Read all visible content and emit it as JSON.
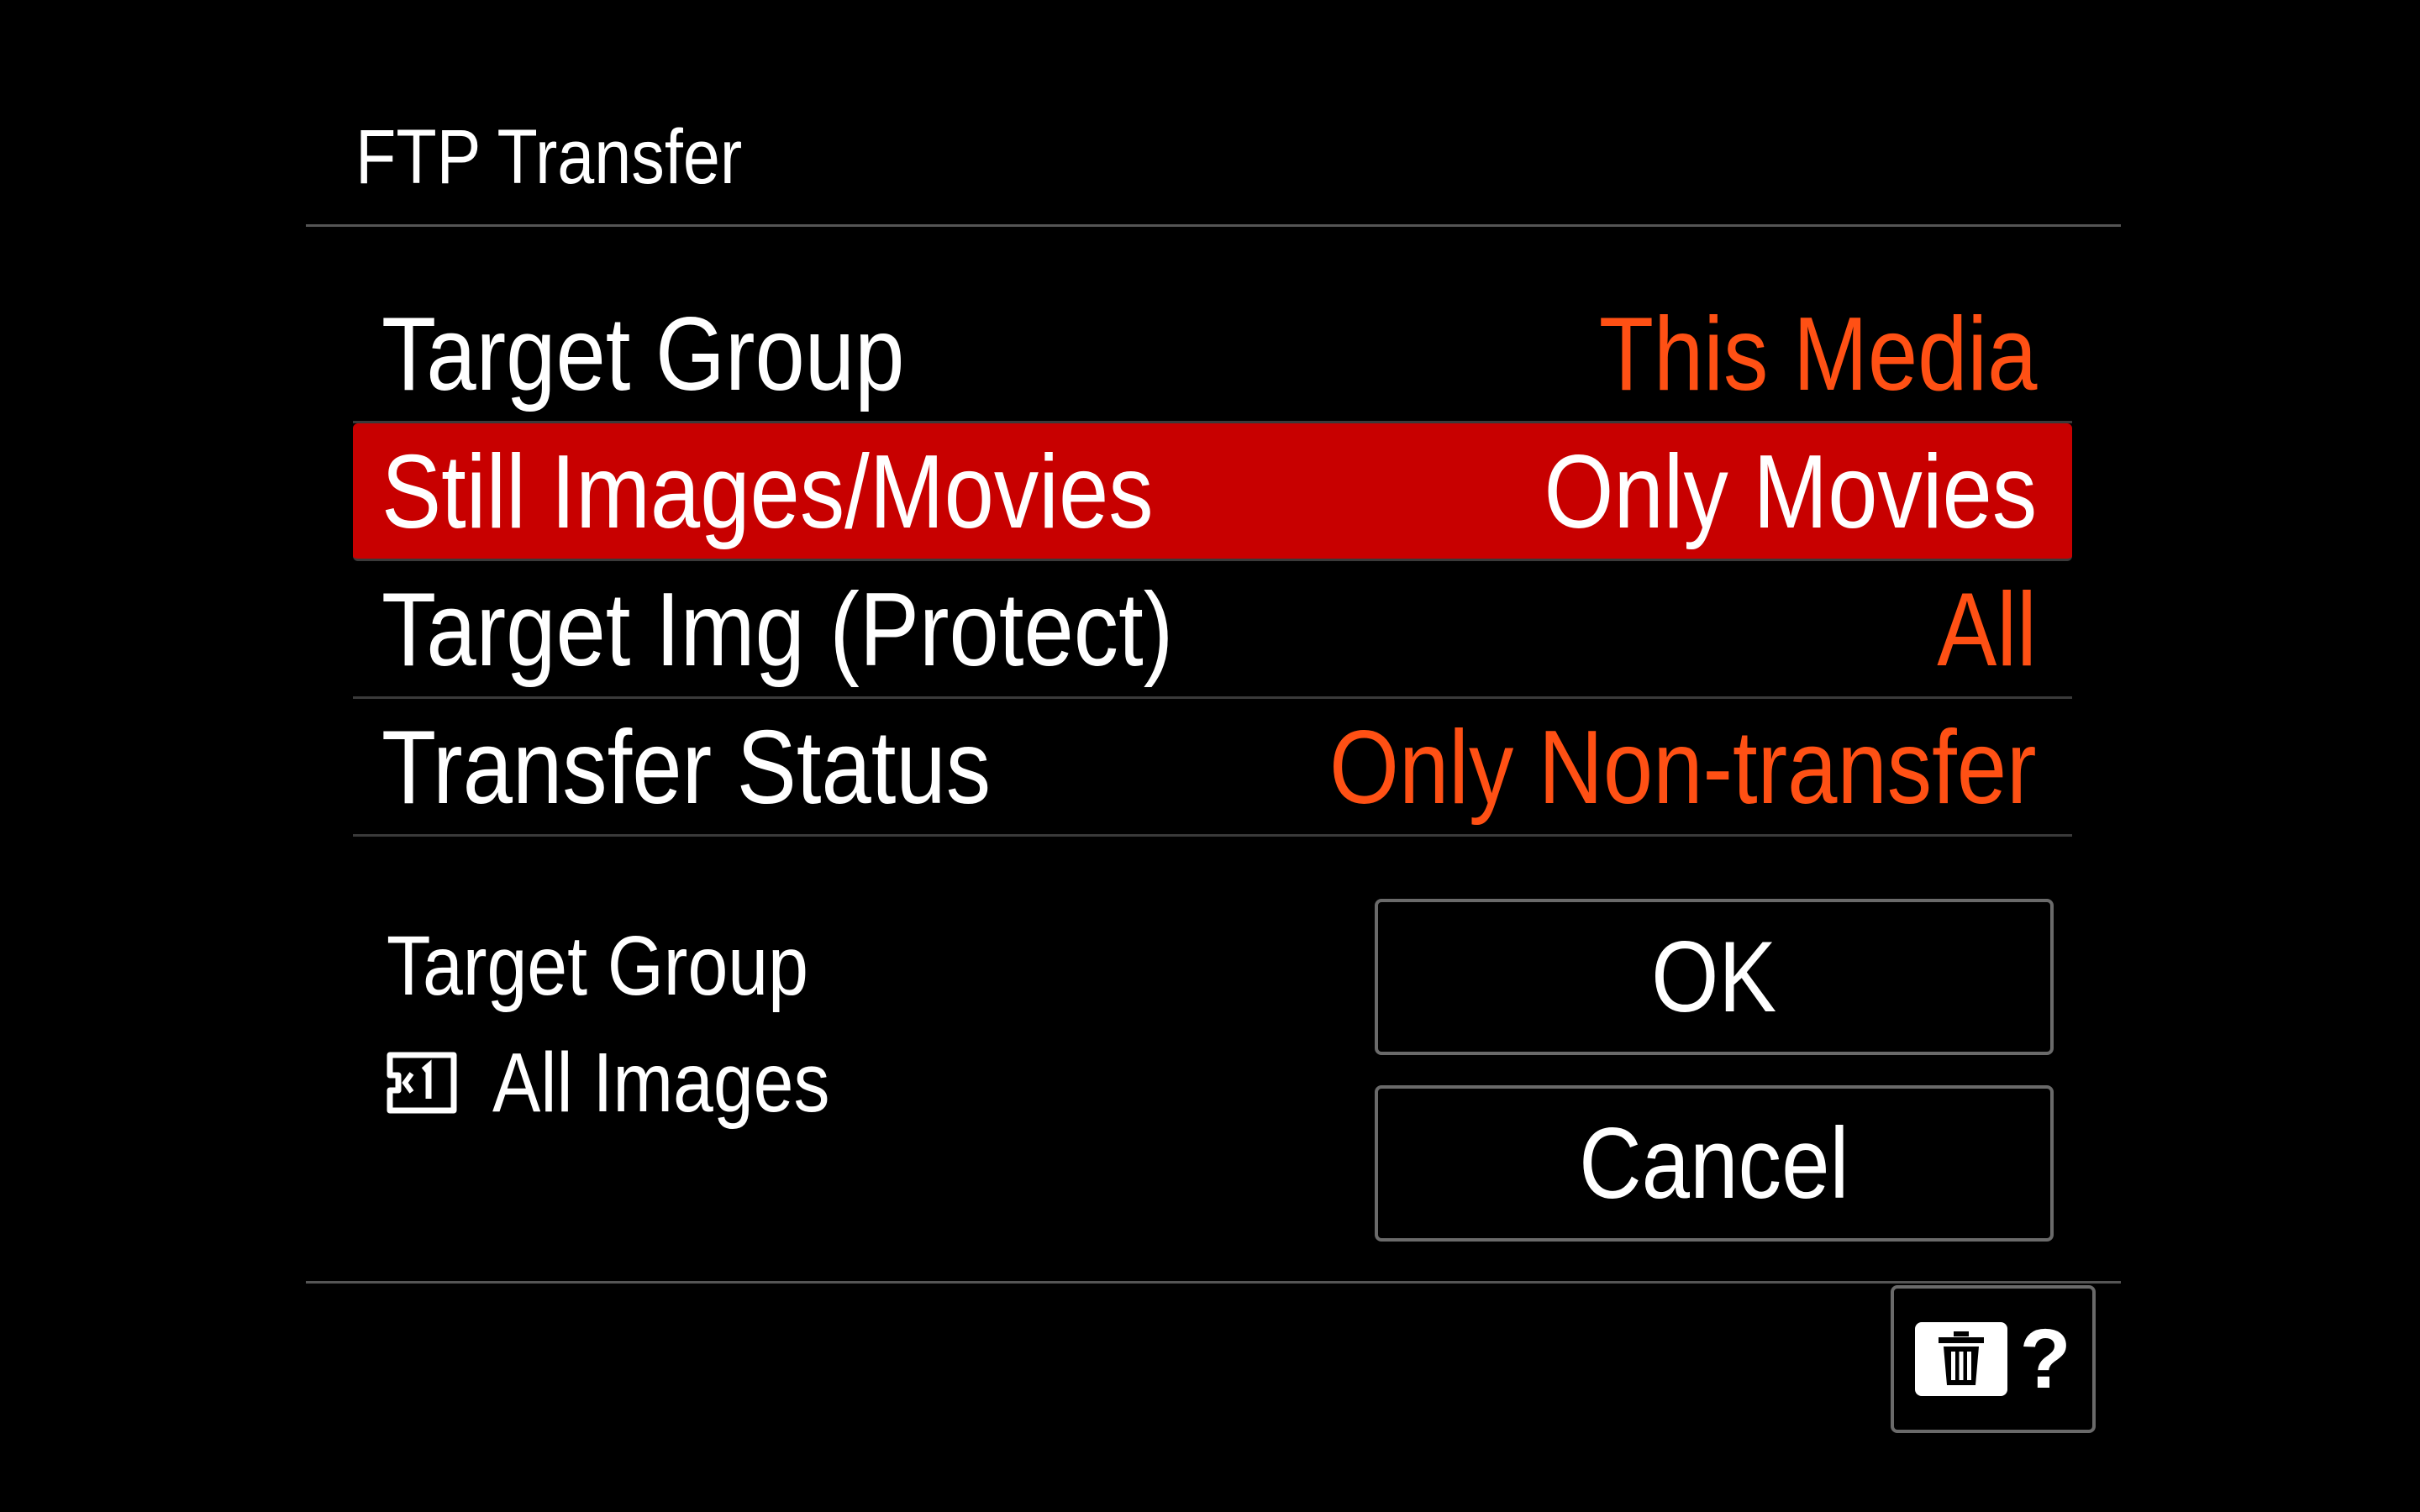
{
  "title": "FTP Transfer",
  "menu": {
    "items": [
      {
        "label": "Target Group",
        "value": "This Media",
        "selected": false
      },
      {
        "label": "Still Images/Movies",
        "value": "Only Movies",
        "selected": true
      },
      {
        "label": "Target Img (Protect)",
        "value": "All",
        "selected": false
      },
      {
        "label": "Transfer Status",
        "value": "Only Non-transfer",
        "selected": false
      }
    ]
  },
  "info": {
    "title": "Target Group",
    "value": "All Images",
    "icon": "memory-card-slot-1-icon"
  },
  "buttons": {
    "ok": "OK",
    "cancel": "Cancel"
  },
  "help": {
    "icon": "trash-icon",
    "mark": "?"
  },
  "colors": {
    "accent_value": "#ff5014",
    "selection": "#c80000",
    "background": "#000000"
  }
}
